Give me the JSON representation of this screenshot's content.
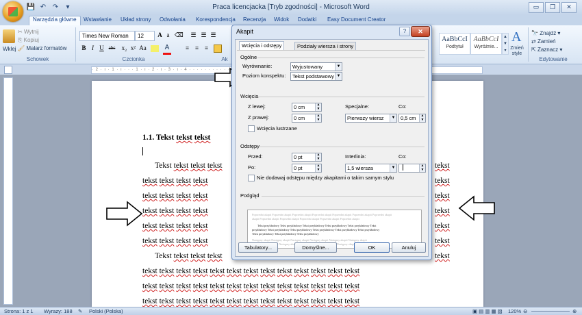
{
  "window": {
    "title": "Praca licencjacka [Tryb zgodności] - Microsoft Word",
    "controls": [
      "▭",
      "❐",
      "✕"
    ]
  },
  "tabs": [
    "Narzędzia główne",
    "Wstawianie",
    "Układ strony",
    "Odwołania",
    "Korespondencja",
    "Recenzja",
    "Widok",
    "Dodatki",
    "Easy Document Creator"
  ],
  "ribbon": {
    "clipboard": {
      "paste": "Wklej",
      "cut": "Wytnij",
      "copy": "Kopiuj",
      "format_painter": "Malarz formatów",
      "label": "Schowek"
    },
    "font": {
      "name": "Times New Roman",
      "size": "12",
      "label": "Czcionka"
    },
    "paragraph": {
      "label": "Ak"
    },
    "styles": {
      "items": [
        {
          "sample": "AaBbCcI",
          "name": "Podtytuł"
        },
        {
          "sample": "AaBbCcI",
          "name": "Wyróżnie..."
        }
      ],
      "change": "Zmień style",
      "label": ""
    },
    "editing": {
      "find": "Znajdź",
      "replace": "Zamień",
      "select": "Zaznacz",
      "label": "Edytowanie"
    }
  },
  "ruler": {
    "text": "· 2 · ı · 1 · ı · · · 1 · ı · 2 · ı · 3 · ı · 4 · · · · · · · · · · · · · · · · · · · · · · · · · · · · · · · · · · 17 · ı · 18 ·"
  },
  "document": {
    "heading": "1.1. Tekst tekst tekst",
    "first_line": "Tekst tekst tekst tekst",
    "line_text": "tekst tekst tekst tekst",
    "right_text": "tekst",
    "bottom_line": "tekst tekst tekst tekst tekst tekst tekst tekst tekst tekst tekst tekst tekst"
  },
  "dialog": {
    "title": "Akapit",
    "tabs": [
      "Wcięcia i odstępy",
      "Podziały wiersza i strony"
    ],
    "general": {
      "section": "Ogólne",
      "alignment_label": "Wyrównanie:",
      "alignment_value": "Wyjustowany",
      "outline_label": "Poziom konspektu:",
      "outline_value": "Tekst podstawowy"
    },
    "indent": {
      "section": "Wcięcia",
      "left_label": "Z lewej:",
      "left_value": "0 cm",
      "right_label": "Z prawej:",
      "right_value": "0 cm",
      "special_label": "Specjalne:",
      "special_value": "Pierwszy wiersz",
      "by_label": "Co:",
      "by_value": "0,5 cm",
      "mirror": "Wcięcia lustrzane"
    },
    "spacing": {
      "section": "Odstępy",
      "before_label": "Przed:",
      "before_value": "0 pt",
      "after_label": "Po:",
      "after_value": "0 pt",
      "line_label": "Interlinia:",
      "line_value": "1,5 wiersza",
      "at_label": "Co:",
      "at_value": "",
      "no_space": "Nie dodawaj odstępu między akapitami o takim samym stylu"
    },
    "preview": {
      "section": "Podgląd",
      "gray1": "Poprzedni akapit Poprzedni akapit Poprzedni akapit Poprzedni akapit Poprzedni akapit Poprzedni akapit Poprzedni akapit",
      "gray2": "akapit Poprzedni akapit Poprzedni akapit Poprzedni akapit Poprzedni akapit Poprzedni akapit",
      "dark1": "Tekst przykładowy Tekst przykładowy Tekst przykładowy Tekst przykładowy Tekst przykładowy Tekst",
      "dark2": "przykładowy Tekst przykładowy Tekst przykładowy Tekst przykładowy Tekst przykładowy Tekst przykładowy",
      "dark3": "Tekst przykładowy Tekst przykładowy Tekst przykładowy",
      "gray3": "Następny akapit Następny akapit Następny akapit Następny akapit Następny akapit Następny akapit",
      "gray4": "akapit Następny akapit Następny akapit Następny akapit Następny akapit Następny akapit"
    },
    "buttons": {
      "tabs": "Tabulatory...",
      "default": "Domyślne...",
      "ok": "OK",
      "cancel": "Anuluj"
    }
  },
  "status": {
    "page": "Strona: 1 z 1",
    "words": "Wyrazy: 188",
    "language": "Polski (Polska)",
    "zoom": "120%"
  }
}
